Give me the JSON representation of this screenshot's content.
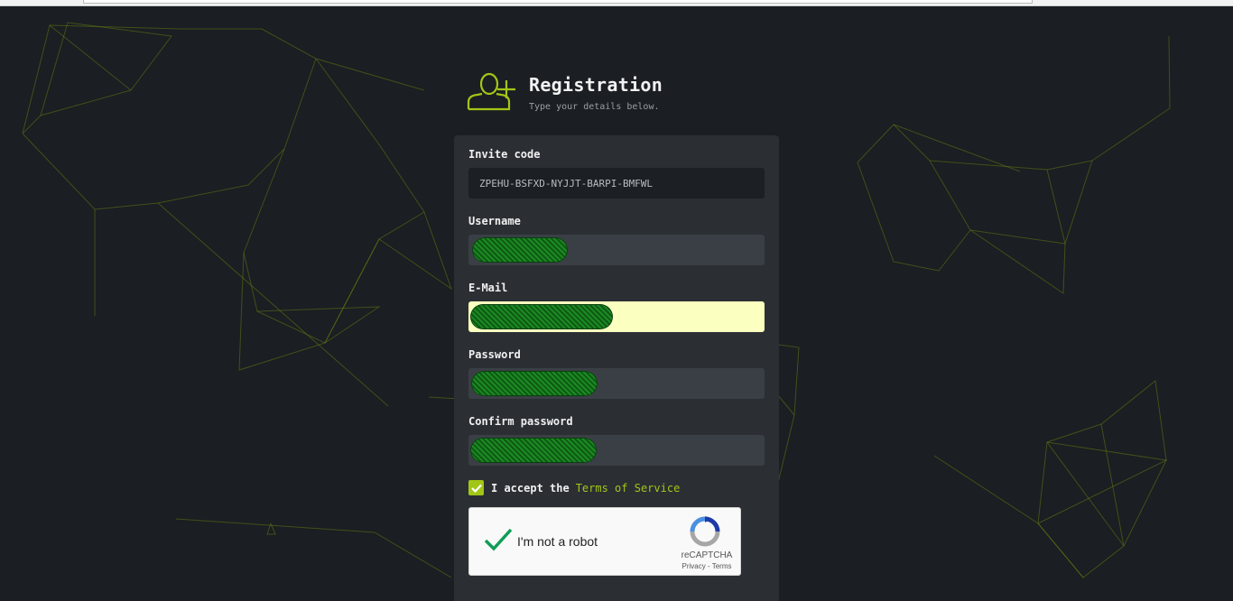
{
  "header": {
    "title": "Registration",
    "subtitle": "Type your details below.",
    "icon": "add-user-icon"
  },
  "form": {
    "invite_label": "Invite code",
    "invite_value": "ZPEHU-BSFXD-NYJJT-BARPI-BMFWL",
    "username_label": "Username",
    "email_label": "E-Mail",
    "password_label": "Password",
    "confirm_label": "Confirm password",
    "tos_prefix": "I accept the",
    "tos_link": "Terms of Service",
    "tos_checked": true
  },
  "captcha": {
    "label": "I'm not a robot",
    "brand": "reCAPTCHA",
    "links": "Privacy - Terms",
    "checked": true
  },
  "colors": {
    "background": "#1b1e22",
    "card": "#2b2f34",
    "accent": "#a2c617",
    "autofill": "#fbffc0"
  }
}
